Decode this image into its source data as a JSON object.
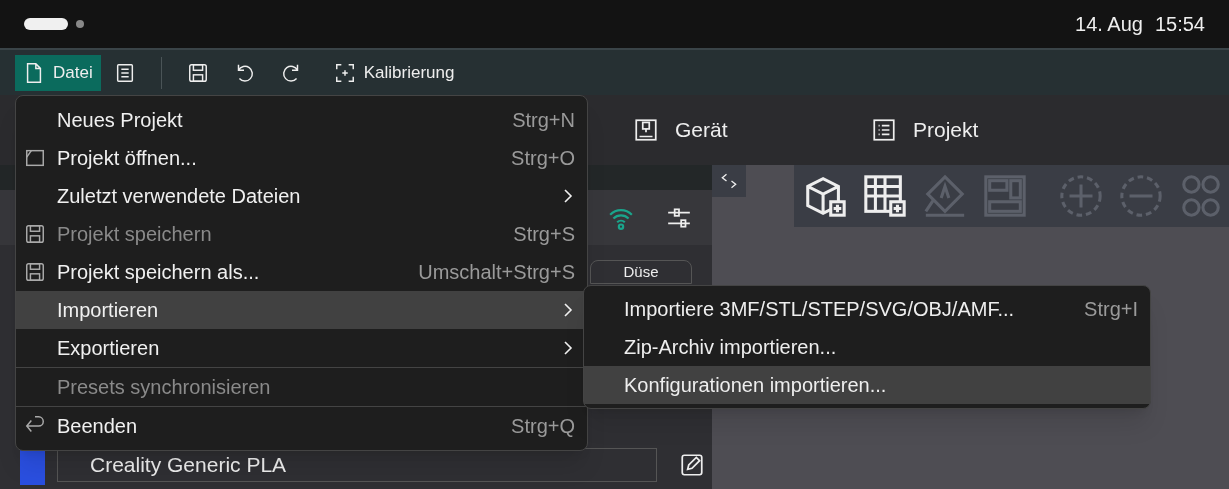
{
  "status_bar": {
    "date": "14. Aug",
    "time": "15:54"
  },
  "toolbar": {
    "file_button": {
      "label": "Datei",
      "selected": true
    },
    "calibration_button": {
      "label": "Kalibrierung"
    }
  },
  "tabs": [
    {
      "label": "Gerät"
    },
    {
      "label": "Projekt"
    }
  ],
  "device_panel": {
    "nozzle_button": "Düse",
    "filament": "Creality Generic PLA"
  },
  "file_menu": [
    {
      "kind": "item",
      "label": "Neues Projekt",
      "shortcut": "Strg+N",
      "disabled": false,
      "submenu": false,
      "selected": false
    },
    {
      "kind": "item",
      "label": "Projekt öffnen...",
      "shortcut": "Strg+O",
      "disabled": false,
      "submenu": false,
      "selected": false
    },
    {
      "kind": "item",
      "label": "Zuletzt verwendete Dateien",
      "disabled": false,
      "submenu": true,
      "selected": false
    },
    {
      "kind": "item",
      "label": "Projekt speichern",
      "shortcut": "Strg+S",
      "disabled": true,
      "submenu": false,
      "selected": false
    },
    {
      "kind": "item",
      "label": "Projekt speichern als...",
      "shortcut": "Umschalt+Strg+S",
      "disabled": false,
      "submenu": false,
      "selected": false
    },
    {
      "kind": "item",
      "label": "Importieren",
      "disabled": false,
      "submenu": true,
      "selected": true
    },
    {
      "kind": "item",
      "label": "Exportieren",
      "disabled": false,
      "submenu": true,
      "selected": false
    },
    {
      "kind": "separator"
    },
    {
      "kind": "item",
      "label": "Presets synchronisieren",
      "disabled": true,
      "submenu": false,
      "selected": false
    },
    {
      "kind": "separator"
    },
    {
      "kind": "item",
      "label": "Beenden",
      "shortcut": "Strg+Q",
      "disabled": false,
      "submenu": false,
      "selected": false
    }
  ],
  "import_submenu": [
    {
      "label": "Importiere 3MF/STL/STEP/SVG/OBJ/AMF...",
      "shortcut": "Strg+I",
      "selected": false
    },
    {
      "label": "Zip-Archiv importieren...",
      "selected": false
    },
    {
      "label": "Konfigurationen importieren...",
      "selected": true
    }
  ]
}
